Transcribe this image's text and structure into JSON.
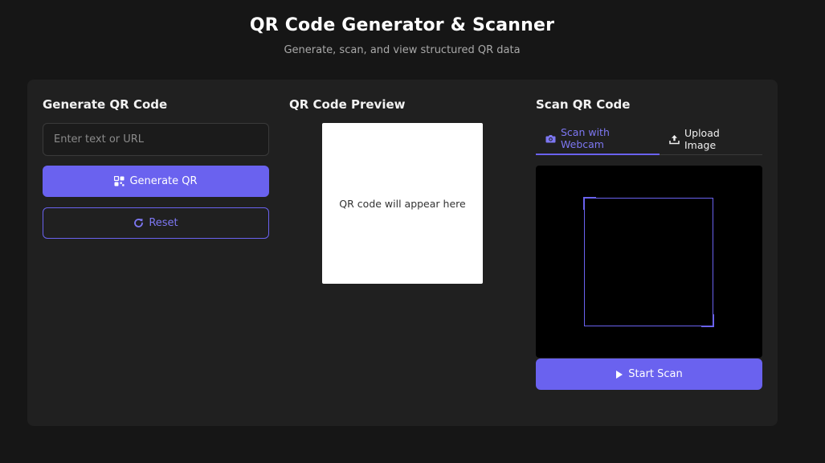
{
  "header": {
    "title": "QR Code Generator & Scanner",
    "subtitle": "Generate, scan, and view structured QR data"
  },
  "generator": {
    "title": "Generate QR Code",
    "input_placeholder": "Enter text or URL",
    "input_value": "",
    "generate_label": "Generate QR",
    "reset_label": "Reset",
    "generate_icon": "qr-grid-icon",
    "reset_icon": "refresh-icon"
  },
  "preview": {
    "title": "QR Code Preview",
    "placeholder_text": "QR code will appear here"
  },
  "scanner": {
    "title": "Scan QR Code",
    "tabs": [
      {
        "label": "Scan with Webcam",
        "icon": "camera-icon",
        "active": true
      },
      {
        "label": "Upload Image",
        "icon": "upload-icon",
        "active": false
      }
    ],
    "start_label": "Start Scan",
    "start_icon": "play-icon"
  },
  "colors": {
    "accent": "#6a62ef",
    "background": "#161616",
    "card": "#202020"
  }
}
